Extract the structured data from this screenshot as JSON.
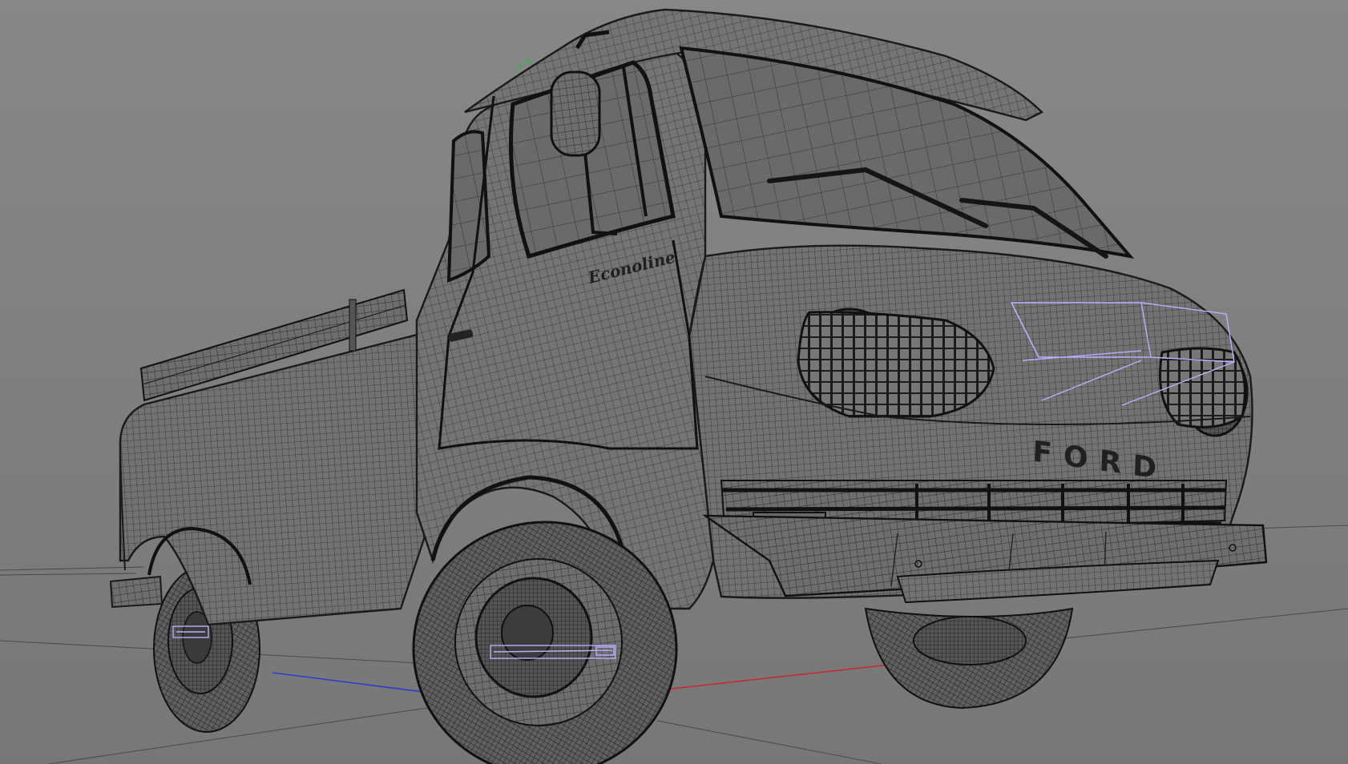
{
  "viewport": {
    "background_color": "#808080",
    "wire_color": "#1a1a1a",
    "selection_color": "#b8b0ff",
    "axis_x_color": "#c8282a",
    "axis_z_color": "#2a36d4",
    "axis_y_color": "#2fb64a"
  },
  "model": {
    "badge_text": "Econoline",
    "grille_letters": "FORD"
  }
}
